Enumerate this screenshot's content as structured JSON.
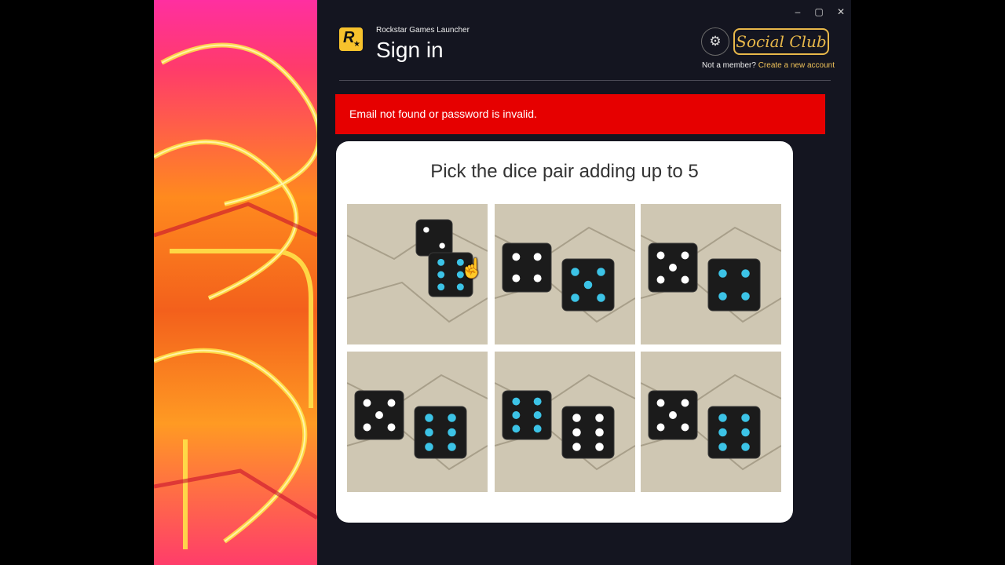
{
  "window": {
    "minimize_glyph": "–",
    "maximize_glyph": "▢",
    "close_glyph": "✕"
  },
  "header": {
    "app_name": "Rockstar Games Launcher",
    "title": "Sign in",
    "logo_text": "R",
    "logo_star": "★",
    "settings_glyph": "⚙",
    "social_club_label": "Social Club",
    "not_member_text": "Not a member?",
    "create_account_link": "Create a new account"
  },
  "error": {
    "message": "Email not found or password is invalid."
  },
  "captcha": {
    "prompt": "Pick the dice pair adding up to 5",
    "tiles": [
      {
        "index": 1,
        "selected": true,
        "die_a": 2,
        "die_b": 6
      },
      {
        "index": 2,
        "selected": false,
        "die_a": 4,
        "die_b": 5
      },
      {
        "index": 3,
        "selected": false,
        "die_a": 5,
        "die_b": 4
      },
      {
        "index": 4,
        "selected": false,
        "die_a": 5,
        "die_b": 6
      },
      {
        "index": 5,
        "selected": false,
        "die_a": 6,
        "die_b": 6
      },
      {
        "index": 6,
        "selected": false,
        "die_a": 5,
        "die_b": 6
      }
    ]
  },
  "colors": {
    "accent": "#f7c22c",
    "social_club": "#e8b84a",
    "error": "#e60000",
    "pip_blue": "#3cc3e6",
    "pip_white": "#ffffff"
  },
  "icons": {
    "logo": "rockstar-logo-icon",
    "settings": "gear-icon",
    "cursor": "hand-pointer-icon"
  }
}
